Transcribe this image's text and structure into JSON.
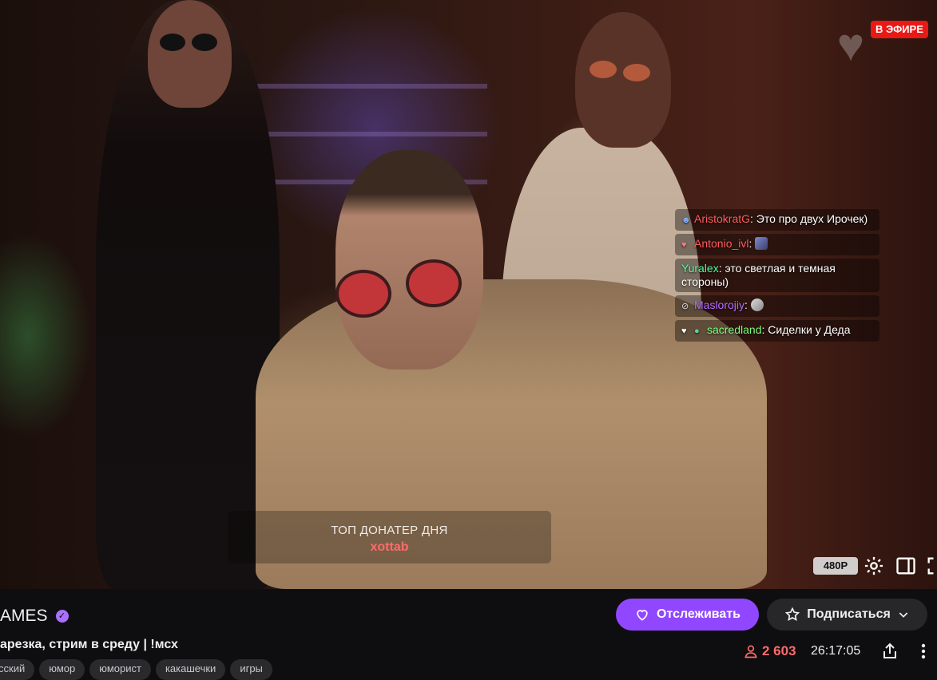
{
  "player": {
    "live_label": "В ЭФИРЕ",
    "quality_label": "480P",
    "chat_overlay": [
      {
        "user": "AristokratG",
        "user_color": "#ff5c5c",
        "icon": "badge-icon",
        "text": ": Это про двух Ирочек)"
      },
      {
        "user": "Antonio_ivl",
        "user_color": "#ff5c5c",
        "icon": "heart-icon",
        "text": ":"
      },
      {
        "user": "Yuralex",
        "user_color": "#4eff9e",
        "icon": "",
        "text": ": это светлая и темная стороны)"
      },
      {
        "user": "Maslorojiy",
        "user_color": "#b06cff",
        "icon": "mute-icon",
        "text": ":"
      },
      {
        "user": "sacredland",
        "user_color": "#7cff7c",
        "icon": "heart-icon",
        "text": ": Сиделки у Деда"
      }
    ],
    "top_donator": {
      "title": "ТОП ДОНАТЕР ДНЯ",
      "name": "xottab"
    }
  },
  "info": {
    "channel_name": "AMES",
    "stream_title": "арезка, стрим в среду | !мсх",
    "tags": [
      "сский",
      "юмор",
      "юморист",
      "какашечки",
      "игры"
    ],
    "follow_label": "Отслеживать",
    "subscribe_label": "Подписаться",
    "viewers": "2 603",
    "uptime": "26:17:05"
  },
  "colors": {
    "accent": "#9147ff",
    "live": "#e91916",
    "viewers": "#ff6b6b",
    "background": "#0e0e10"
  }
}
